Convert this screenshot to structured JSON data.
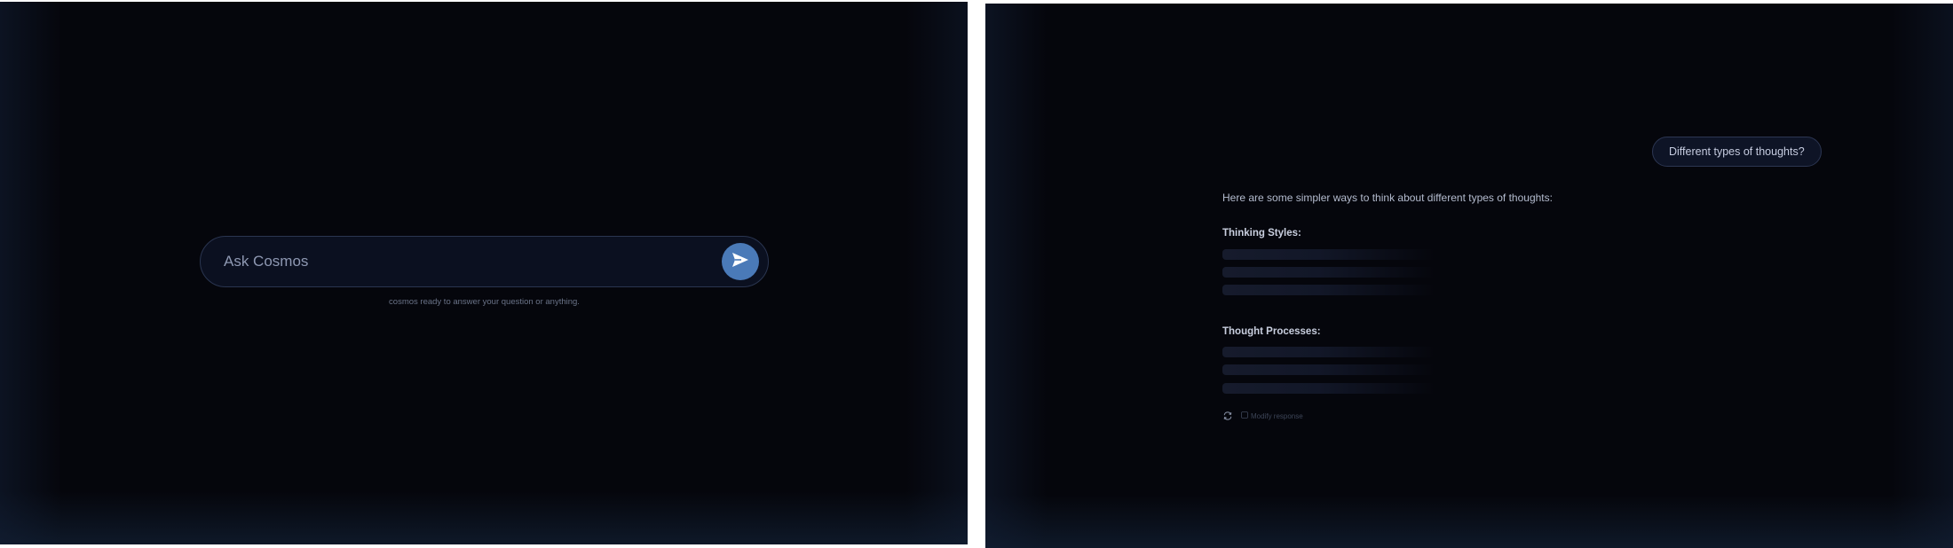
{
  "left_screen": {
    "ask_bar": {
      "placeholder": "Ask Cosmos",
      "send_icon": "paper-plane-icon"
    },
    "hint_text": "cosmos ready to answer your question or anything."
  },
  "right_screen": {
    "user_message": "Different types of thoughts?",
    "response": {
      "intro": "Here are some simpler ways to think about different types of thoughts:",
      "sections": [
        {
          "title": "Thinking Styles:",
          "loading_lines": 3
        },
        {
          "title": "Thought Processes:",
          "loading_lines": 3
        }
      ],
      "actions": {
        "regenerate_icon": "refresh-icon",
        "modify_label": "Modify response"
      }
    }
  },
  "colors": {
    "background": "#05060c",
    "accent": "#4a7ab8",
    "bubble_border": "#2c3652"
  }
}
